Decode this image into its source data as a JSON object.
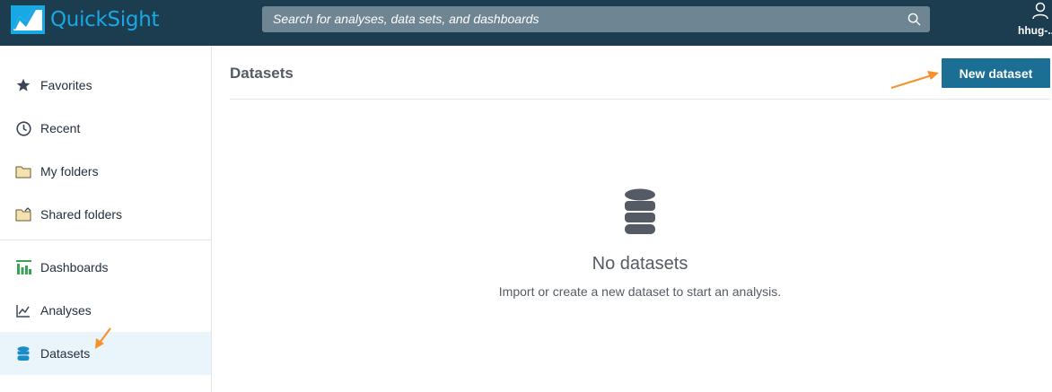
{
  "app": {
    "name": "QuickSight"
  },
  "search": {
    "placeholder": "Search for analyses, data sets, and dashboards"
  },
  "user": {
    "name": "hhug-..."
  },
  "sidebar": {
    "items": [
      {
        "label": "Favorites",
        "icon": "star-icon"
      },
      {
        "label": "Recent",
        "icon": "clock-icon"
      },
      {
        "label": "My folders",
        "icon": "folder-icon"
      },
      {
        "label": "Shared folders",
        "icon": "shared-folder-icon"
      },
      {
        "label": "Dashboards",
        "icon": "dashboard-icon"
      },
      {
        "label": "Analyses",
        "icon": "line-chart-icon"
      },
      {
        "label": "Datasets",
        "icon": "database-icon",
        "active": true
      }
    ]
  },
  "main": {
    "title": "Datasets",
    "new_button": "New dataset",
    "empty": {
      "title": "No datasets",
      "subtitle": "Import or create a new dataset to start an analysis."
    }
  },
  "colors": {
    "topbar": "#1c3c50",
    "accent": "#18a8e3",
    "button": "#1b6f95",
    "annotation_arrow": "#f5922b"
  }
}
